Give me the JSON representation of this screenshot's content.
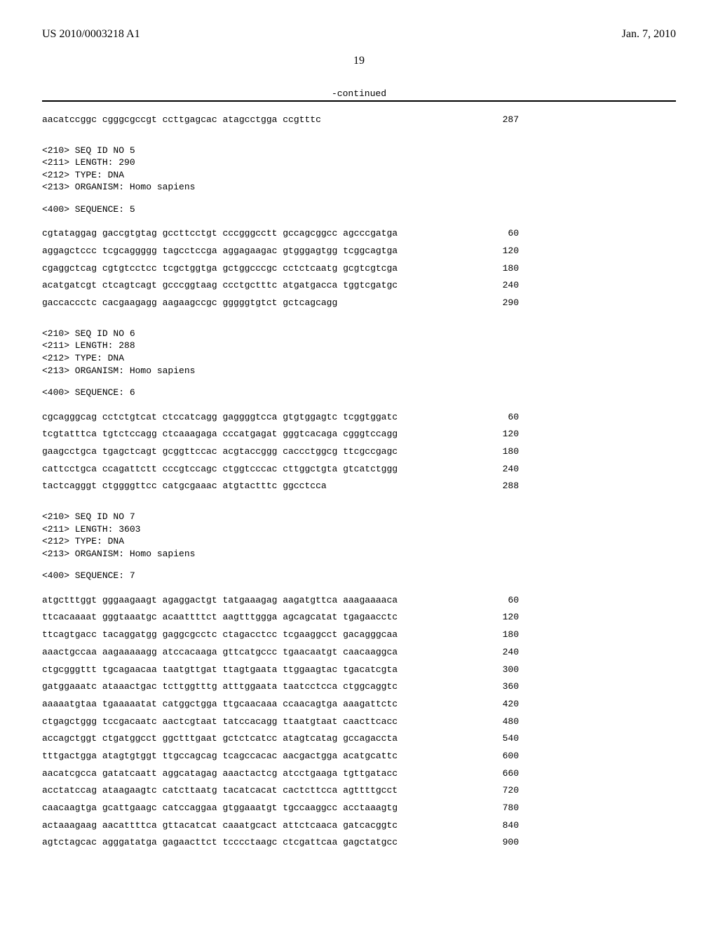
{
  "header": {
    "pub_number": "US 2010/0003218 A1",
    "pub_date": "Jan. 7, 2010"
  },
  "page_number": "19",
  "continued_label": "-continued",
  "blocks": [
    {
      "type": "seq",
      "lines": [
        {
          "text": "aacatccggc cgggcgccgt ccttgagcac atagcctgga ccgtttc",
          "num": "287"
        }
      ]
    },
    {
      "type": "header",
      "lines": [
        "<210> SEQ ID NO 5",
        "<211> LENGTH: 290",
        "<212> TYPE: DNA",
        "<213> ORGANISM: Homo sapiens"
      ]
    },
    {
      "type": "header",
      "lines": [
        "<400> SEQUENCE: 5"
      ]
    },
    {
      "type": "seq",
      "lines": [
        {
          "text": "cgtataggag gaccgtgtag gccttcctgt cccgggcctt gccagcggcc agcccgatga",
          "num": "60"
        },
        {
          "text": "aggagctccc tcgcaggggg tagcctccga aggagaagac gtgggagtgg tcggcagtga",
          "num": "120"
        },
        {
          "text": "cgaggctcag cgtgtcctcc tcgctggtga gctggcccgc cctctcaatg gcgtcgtcga",
          "num": "180"
        },
        {
          "text": "acatgatcgt ctcagtcagt gcccggtaag ccctgctttc atgatgacca tggtcgatgc",
          "num": "240"
        },
        {
          "text": "gaccaccctc cacgaagagg aagaagccgc gggggtgtct gctcagcagg",
          "num": "290"
        }
      ]
    },
    {
      "type": "header",
      "lines": [
        "<210> SEQ ID NO 6",
        "<211> LENGTH: 288",
        "<212> TYPE: DNA",
        "<213> ORGANISM: Homo sapiens"
      ]
    },
    {
      "type": "header",
      "lines": [
        "<400> SEQUENCE: 6"
      ]
    },
    {
      "type": "seq",
      "lines": [
        {
          "text": "cgcagggcag cctctgtcat ctccatcagg gaggggtcca gtgtggagtc tcggtggatc",
          "num": "60"
        },
        {
          "text": "tcgtatttca tgtctccagg ctcaaagaga cccatgagat gggtcacaga cgggtccagg",
          "num": "120"
        },
        {
          "text": "gaagcctgca tgagctcagt gcggttccac acgtaccggg caccctggcg ttcgccgagc",
          "num": "180"
        },
        {
          "text": "cattcctgca ccagattctt cccgtccagc ctggtcccac cttggctgta gtcatctggg",
          "num": "240"
        },
        {
          "text": "tactcagggt ctggggttcc catgcgaaac atgtactttc ggcctcca",
          "num": "288"
        }
      ]
    },
    {
      "type": "header",
      "lines": [
        "<210> SEQ ID NO 7",
        "<211> LENGTH: 3603",
        "<212> TYPE: DNA",
        "<213> ORGANISM: Homo sapiens"
      ]
    },
    {
      "type": "header",
      "lines": [
        "<400> SEQUENCE: 7"
      ]
    },
    {
      "type": "seq",
      "lines": [
        {
          "text": "atgctttggt gggaagaagt agaggactgt tatgaaagag aagatgttca aaagaaaaca",
          "num": "60"
        },
        {
          "text": "ttcacaaaat gggtaaatgc acaattttct aagtttggga agcagcatat tgagaacctc",
          "num": "120"
        },
        {
          "text": "ttcagtgacc tacaggatgg gaggcgcctc ctagacctcc tcgaaggcct gacagggcaa",
          "num": "180"
        },
        {
          "text": "aaactgccaa aagaaaaagg atccacaaga gttcatgccc tgaacaatgt caacaaggca",
          "num": "240"
        },
        {
          "text": "ctgcgggttt tgcagaacaa taatgttgat ttagtgaata ttggaagtac tgacatcgta",
          "num": "300"
        },
        {
          "text": "gatggaaatc ataaactgac tcttggtttg atttggaata taatcctcca ctggcaggtc",
          "num": "360"
        },
        {
          "text": "aaaaatgtaa tgaaaaatat catggctgga ttgcaacaaa ccaacagtga aaagattctc",
          "num": "420"
        },
        {
          "text": "ctgagctggg tccgacaatc aactcgtaat tatccacagg ttaatgtaat caacttcacc",
          "num": "480"
        },
        {
          "text": "accagctggt ctgatggcct ggctttgaat gctctcatcc atagtcatag gccagaccta",
          "num": "540"
        },
        {
          "text": "tttgactgga atagtgtggt ttgccagcag tcagccacac aacgactgga acatgcattc",
          "num": "600"
        },
        {
          "text": "aacatcgcca gatatcaatt aggcatagag aaactactcg atcctgaaga tgttgatacc",
          "num": "660"
        },
        {
          "text": "acctatccag ataagaagtc catcttaatg tacatcacat cactcttcca agttttgcct",
          "num": "720"
        },
        {
          "text": "caacaagtga gcattgaagc catccaggaa gtggaaatgt tgccaaggcc acctaaagtg",
          "num": "780"
        },
        {
          "text": "actaaagaag aacattttca gttacatcat caaatgcact attctcaaca gatcacggtc",
          "num": "840"
        },
        {
          "text": "agtctagcac agggatatga gagaacttct tcccctaagc ctcgattcaa gagctatgcc",
          "num": "900"
        }
      ]
    }
  ]
}
